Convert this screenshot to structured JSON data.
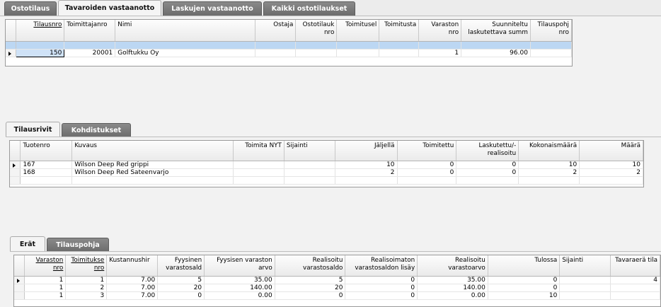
{
  "top_tabs": [
    "Ostotilaus",
    "Tavaroiden vastaanotto",
    "Laskujen vastaanotto",
    "Kaikki ostotilaukset"
  ],
  "orders": {
    "columns": [
      "Tilausnro",
      "Toimittajanro",
      "Nimi",
      "Ostaja",
      "Ostotilauk nro",
      "Toimitusel",
      "Toimitusta",
      "Varaston nro",
      "Suunniteltu laskutettava summ",
      "Tilauspohj nro"
    ],
    "rows": [
      [
        "150",
        "20001",
        "Golftukku Oy",
        "",
        "",
        "",
        "",
        "1",
        "96.00",
        ""
      ]
    ]
  },
  "mid_tabs": [
    "Tilausrivit",
    "Kohdistukset"
  ],
  "lines": {
    "columns": [
      "Tuotenro",
      "Kuvaus",
      "Toimita NYT",
      "Sijainti",
      "Jäljellä",
      "Toimitettu",
      "Laskutettu/- realisoitu",
      "Kokonaismäärä",
      "Määrä"
    ],
    "rows": [
      [
        "167",
        "Wilson Deep Red grippi",
        "",
        "",
        "10",
        "0",
        "0",
        "10",
        "10"
      ],
      [
        "168",
        "Wilson Deep Red Sateenvarjo",
        "",
        "",
        "2",
        "0",
        "0",
        "2",
        "2"
      ]
    ]
  },
  "bottom_tabs": [
    "Erät",
    "Tilauspohja"
  ],
  "lots": {
    "columns": [
      "Varaston nro",
      "Toimitukse nro",
      "Kustannushir",
      "Fyysinen varastosald",
      "Fyysisen varaston arvo",
      "Realisoitu varastosaldo",
      "Realisoimaton varastosaldon lisäy",
      "Realisoitu varastoarvo",
      "Tulossa",
      "Sijainti",
      "Tavaraerä tila"
    ],
    "rows": [
      [
        "1",
        "1",
        "7.00",
        "5",
        "35.00",
        "5",
        "0",
        "35.00",
        "0",
        "",
        "4"
      ],
      [
        "1",
        "2",
        "7.00",
        "20",
        "140.00",
        "20",
        "0",
        "140.00",
        "0",
        "",
        ""
      ],
      [
        "1",
        "3",
        "7.00",
        "0",
        "0.00",
        "0",
        "0",
        "0.00",
        "10",
        "",
        ""
      ]
    ]
  }
}
